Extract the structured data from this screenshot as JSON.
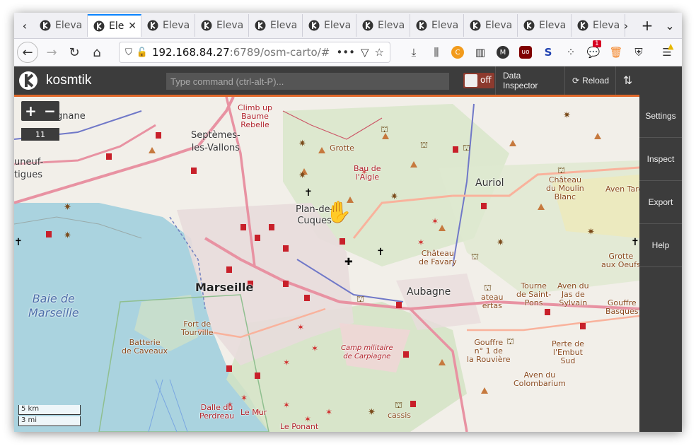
{
  "browser": {
    "tabs": [
      {
        "label": "Eleva",
        "active": false
      },
      {
        "label": "Ele",
        "active": true
      },
      {
        "label": "Eleva",
        "active": false
      },
      {
        "label": "Eleva",
        "active": false
      },
      {
        "label": "Eleva",
        "active": false
      },
      {
        "label": "Eleva",
        "active": false
      },
      {
        "label": "Eleva",
        "active": false
      },
      {
        "label": "Eleva",
        "active": false
      },
      {
        "label": "Eleva",
        "active": false
      },
      {
        "label": "Eleva",
        "active": false
      },
      {
        "label": "Eleva",
        "active": false
      }
    ],
    "tab_close": "✕",
    "url_host": "192.168.84.27",
    "url_path": ":6789/osm-carto/#",
    "url_more": "•••",
    "notification_badge": "1"
  },
  "kosmtik": {
    "title": "kosmtik",
    "command_placeholder": "Type command (ctrl-alt-P)...",
    "toggle_label": "off",
    "data_inspector": "Data Inspector",
    "reload": "Reload",
    "sidebar": [
      "Settings",
      "Inspect",
      "Export",
      "Help"
    ]
  },
  "map": {
    "zoom_in": "+",
    "zoom_out": "−",
    "zoom_level": "11",
    "scale_km": "5 km",
    "scale_mi": "3 mi",
    "labels": {
      "marseille": "Marseille",
      "aubagne": "Aubagne",
      "auriol": "Auriol",
      "plan_de_cuques": "Plan-de-\nCuques",
      "septemes": "Septèmes-\nles-Vallons",
      "baie": "Baie de\nMarseille",
      "gnane": "gnane",
      "neuf": "uneuf-\ntigues",
      "climb_up": "Climb up\nBaume\nRebelle",
      "grotte": "Grotte",
      "bau": "Bau de\nl'Aigle",
      "chateau_moulin": "Château\ndu Moulin\nBlanc",
      "aven_tard": "Aven Tard",
      "chateau_favary": "Château\nde Favary",
      "grotte_oeufs": "Grotte\naux Oeufs",
      "tourne": "Tourne\nde Saint-\nPons",
      "aven_sylvain": "Aven du\nJas de\nSylvain",
      "gouffre_basques": "Gouffre\nBasques",
      "fort_tourville": "Fort de\nTourville",
      "batterie": "Batterie\nde Caveaux",
      "camp": "Camp militaire\nde Carpiagne",
      "gouffre_rouviere": "Gouffre\nn° 1 de\nla Rouvière",
      "perte": "Perte de\nl'Embut\nSud",
      "aven_colombarium": "Aven du\nColombarium",
      "dalle": "Dalle du\nPerdreau",
      "le_mur": "Le Mur",
      "le_ponant": "Le Ponant",
      "cassis": "cassis",
      "chateau_bertas": "ateau\nertas"
    }
  }
}
